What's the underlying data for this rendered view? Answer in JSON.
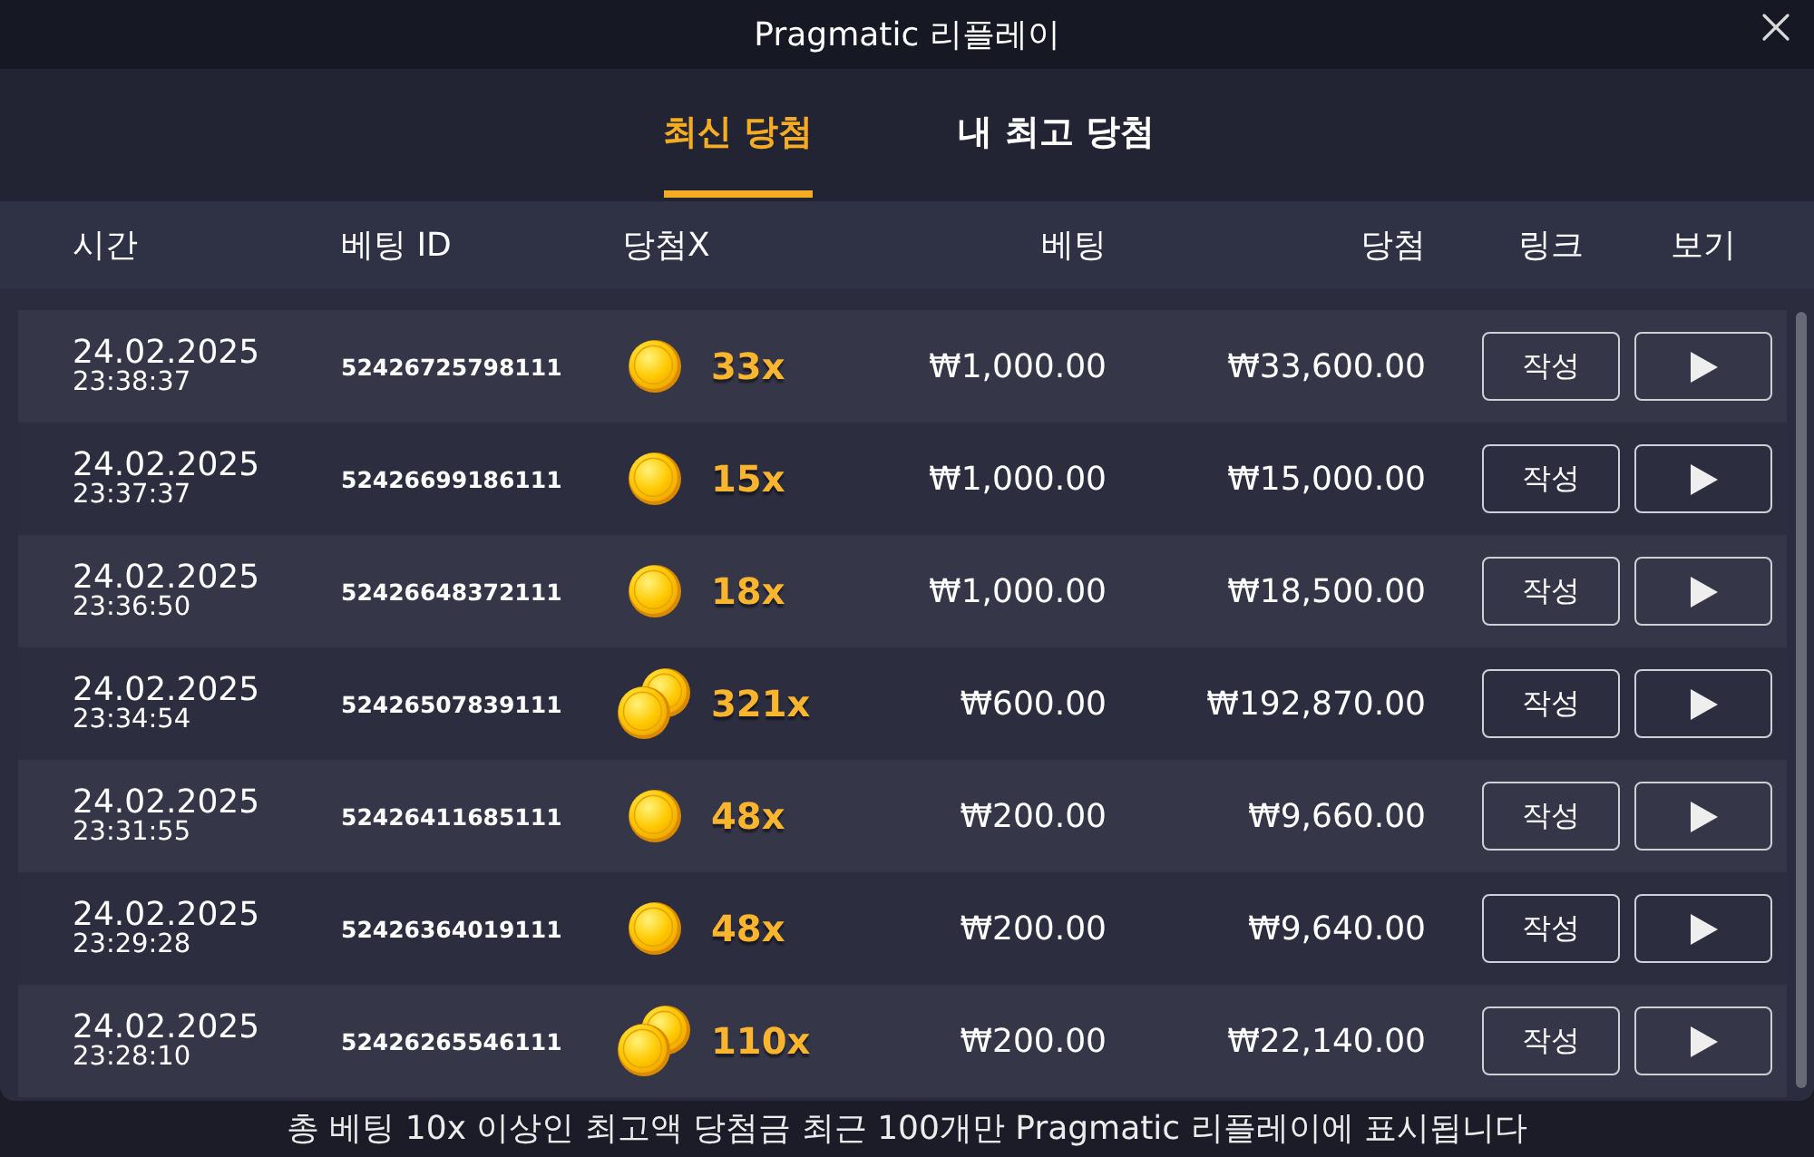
{
  "window": {
    "title": "Pragmatic 리플레이"
  },
  "tabs": [
    {
      "label": "최신 당첨",
      "selected": true
    },
    {
      "label": "내 최고 당첨",
      "selected": false
    }
  ],
  "table": {
    "columns": [
      "시간",
      "베팅 ID",
      "당첨X",
      "베팅",
      "당첨",
      "링크",
      "보기"
    ],
    "rows": [
      {
        "date": "24.02.2025",
        "time": "23:38:37",
        "bet_id": "52426725798111",
        "kind": "single_coin",
        "multiplier": "33x",
        "bet": "₩1,000.00",
        "win": "₩33,600.00",
        "link_button": "작성"
      },
      {
        "date": "24.02.2025",
        "time": "23:37:37",
        "bet_id": "52426699186111",
        "kind": "single_coin",
        "multiplier": "15x",
        "bet": "₩1,000.00",
        "win": "₩15,000.00",
        "link_button": "작성"
      },
      {
        "date": "24.02.2025",
        "time": "23:36:50",
        "bet_id": "52426648372111",
        "kind": "single_coin",
        "multiplier": "18x",
        "bet": "₩1,000.00",
        "win": "₩18,500.00",
        "link_button": "작성"
      },
      {
        "date": "24.02.2025",
        "time": "23:34:54",
        "bet_id": "52426507839111",
        "kind": "two_coins",
        "multiplier": "321x",
        "bet": "₩600.00",
        "win": "₩192,870.00",
        "link_button": "작성"
      },
      {
        "date": "24.02.2025",
        "time": "23:31:55",
        "bet_id": "52426411685111",
        "kind": "single_coin",
        "multiplier": "48x",
        "bet": "₩200.00",
        "win": "₩9,660.00",
        "link_button": "작성"
      },
      {
        "date": "24.02.2025",
        "time": "23:29:28",
        "bet_id": "52426364019111",
        "kind": "single_coin",
        "multiplier": "48x",
        "bet": "₩200.00",
        "win": "₩9,640.00",
        "link_button": "작성"
      },
      {
        "date": "24.02.2025",
        "time": "23:28:10",
        "bet_id": "52426265546111",
        "kind": "two_coins",
        "multiplier": "110x",
        "bet": "₩200.00",
        "win": "₩22,140.00",
        "link_button": "작성"
      }
    ]
  },
  "footer": "총 베팅 10x 이상인 최고액 당첨금 최근 100개만 Pragmatic 리플레이에 표시됩니다"
}
